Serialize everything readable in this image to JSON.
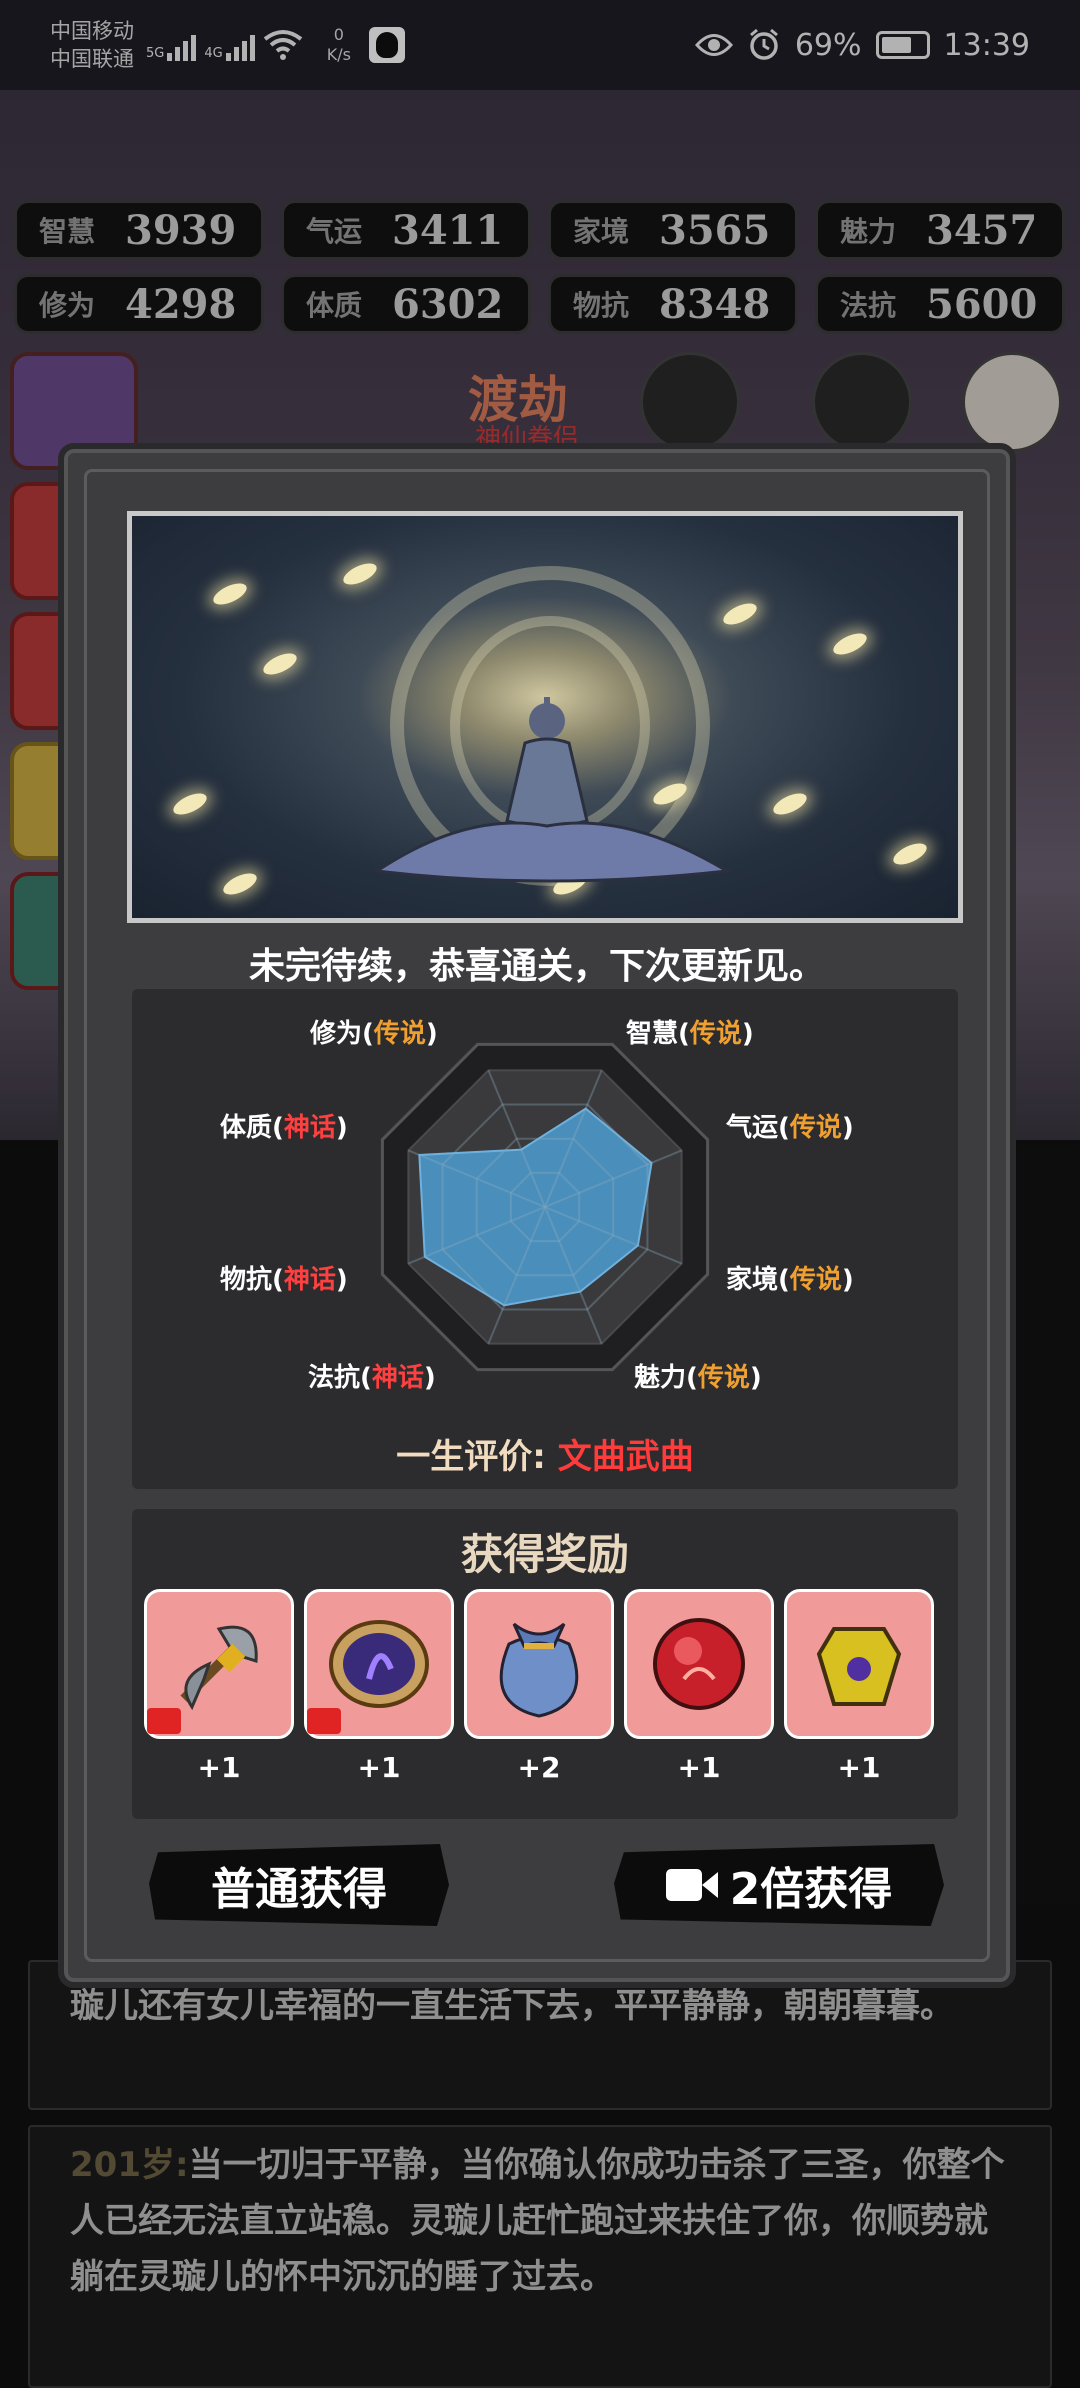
{
  "statusbar": {
    "carrier1": "中国移动",
    "carrier2": "中国联通",
    "net1": "5G",
    "net2": "4G",
    "speed_value": "0",
    "speed_unit": "K/s",
    "battery": "69%",
    "battery_level": 0.69,
    "time": "13:39"
  },
  "stats": [
    {
      "name": "智慧",
      "value": "3939"
    },
    {
      "name": "气运",
      "value": "3411"
    },
    {
      "name": "家境",
      "value": "3565"
    },
    {
      "name": "魅力",
      "value": "3457"
    },
    {
      "name": "修为",
      "value": "4298"
    },
    {
      "name": "体质",
      "value": "6302"
    },
    {
      "name": "物抗",
      "value": "8348"
    },
    {
      "name": "法抗",
      "value": "5600"
    }
  ],
  "background": {
    "tab_title": "渡劫",
    "tab_sub": "神仙眷侣",
    "story1": "璇儿还有女儿幸福的一直生活下去，平平静静，朝朝暮暮。",
    "story2_age": "201岁:",
    "story2": "当一切归于平静，当你确认你成功击杀了三圣，你整个人已经无法直立站稳。灵璇儿赶忙跑过来扶住了你，你顺势就躺在灵璇儿的怀中沉沉的睡了过去。"
  },
  "modal": {
    "congrats": "未完待续，恭喜通关，下次更新见。",
    "radar": {
      "labels": [
        {
          "name": "修为",
          "grade": "传说",
          "tier": "lg"
        },
        {
          "name": "智慧",
          "grade": "传说",
          "tier": "lg"
        },
        {
          "name": "气运",
          "grade": "传说",
          "tier": "lg"
        },
        {
          "name": "家境",
          "grade": "传说",
          "tier": "lg"
        },
        {
          "name": "魅力",
          "grade": "传说",
          "tier": "lg"
        },
        {
          "name": "法抗",
          "grade": "神话",
          "tier": "mh"
        },
        {
          "name": "物抗",
          "grade": "神话",
          "tier": "mh"
        },
        {
          "name": "体质",
          "grade": "神话",
          "tier": "mh"
        }
      ],
      "values": [
        0.42,
        0.72,
        0.78,
        0.68,
        0.62,
        0.72,
        0.88,
        0.92
      ],
      "fill_color": "#4a8fbc"
    },
    "evaluation_label": "一生评价:",
    "evaluation_value": "文曲武曲",
    "rewards_title": "获得奖励",
    "rewards": [
      {
        "icon": "golden-axe-icon",
        "count": "+1"
      },
      {
        "icon": "mirror-icon",
        "count": "+1"
      },
      {
        "icon": "pouch-icon",
        "count": "+2"
      },
      {
        "icon": "red-orb-icon",
        "count": "+1"
      },
      {
        "icon": "golden-armor-icon",
        "count": "+1"
      }
    ],
    "btn_normal": "普通获得",
    "btn_double": "2倍获得"
  }
}
